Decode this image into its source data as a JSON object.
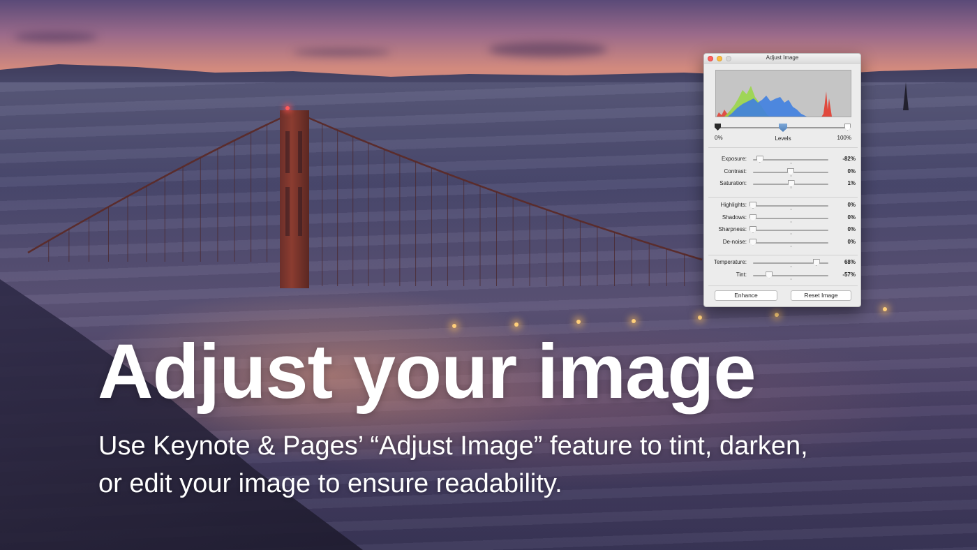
{
  "headline": "Adjust your image",
  "subheadline_lines": [
    "Use Keynote & Pages’ “Adjust Image” feature to tint, darken,",
    "or edit your image to ensure readability."
  ],
  "panel": {
    "title": "Adjust Image",
    "levels": {
      "label": "Levels",
      "min_label": "0%",
      "max_label": "100%"
    },
    "groups": [
      [
        {
          "label": "Exposure:",
          "value": "-82%",
          "position": 0.09
        },
        {
          "label": "Contrast:",
          "value": "0%",
          "position": 0.5
        },
        {
          "label": "Saturation:",
          "value": "1%",
          "position": 0.505
        }
      ],
      [
        {
          "label": "Highlights:",
          "value": "0%",
          "position": 0.0
        },
        {
          "label": "Shadows:",
          "value": "0%",
          "position": 0.0
        },
        {
          "label": "Sharpness:",
          "value": "0%",
          "position": 0.0
        },
        {
          "label": "De-noise:",
          "value": "0%",
          "position": 0.0
        }
      ],
      [
        {
          "label": "Temperature:",
          "value": "68%",
          "position": 0.84
        },
        {
          "label": "Tint:",
          "value": "-57%",
          "position": 0.215
        }
      ]
    ],
    "buttons": {
      "enhance": "Enhance",
      "reset": "Reset Image"
    }
  },
  "colors": {
    "histogram_blue": "#3f7fe0",
    "histogram_green": "#9ad64a",
    "histogram_red": "#e33b2e",
    "levels_mid_knob": "#5a88c2"
  },
  "icons": [
    "close-window-icon",
    "minimize-window-icon",
    "zoom-window-icon"
  ]
}
